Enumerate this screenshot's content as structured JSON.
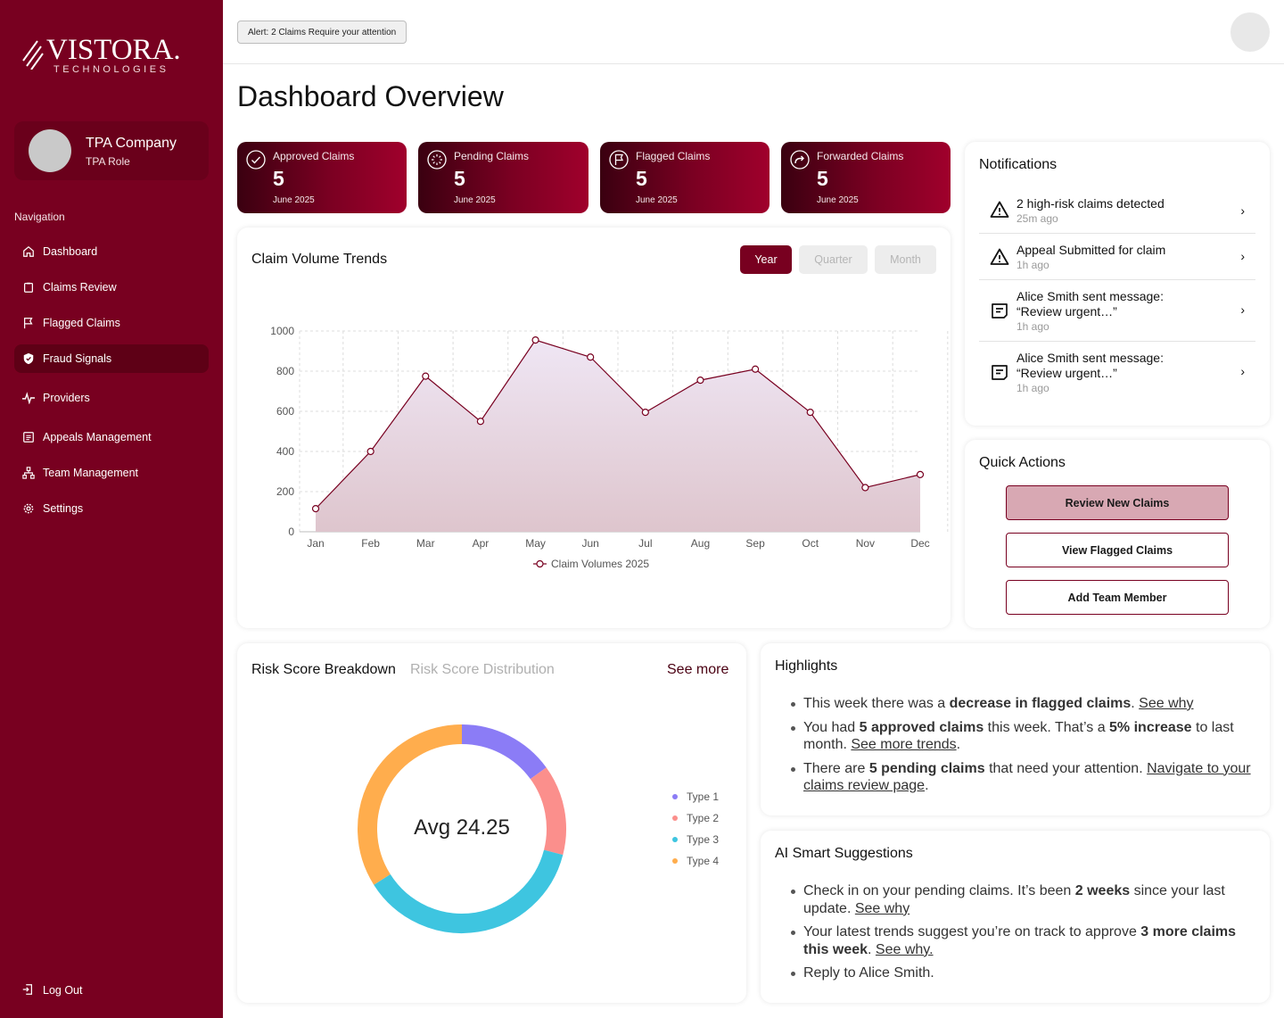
{
  "brand": {
    "name": "VISTORA.",
    "sub": "TECHNOLOGIES"
  },
  "profile": {
    "company": "TPA Company",
    "role": "TPA Role"
  },
  "nav": {
    "title": "Navigation",
    "items": [
      {
        "label": "Dashboard",
        "icon": "home-icon"
      },
      {
        "label": "Claims Review",
        "icon": "clipboard-icon"
      },
      {
        "label": "Flagged Claims",
        "icon": "flag-icon"
      },
      {
        "label": "Fraud Signals",
        "icon": "shield-icon"
      },
      {
        "label": "Providers",
        "icon": "activity-icon"
      },
      {
        "label": "Appeals Management",
        "icon": "document-icon"
      },
      {
        "label": "Team Management",
        "icon": "org-chart-icon"
      },
      {
        "label": "Settings",
        "icon": "gear-icon"
      }
    ],
    "active": "Fraud Signals",
    "logout": "Log Out"
  },
  "topbar": {
    "alert": "Alert: 2 Claims Require your attention"
  },
  "page": {
    "title": "Dashboard Overview"
  },
  "stats": [
    {
      "label": "Approved Claims",
      "value": "5",
      "date": "June 2025",
      "icon": "check-circle-icon"
    },
    {
      "label": "Pending Claims",
      "value": "5",
      "date": "June 2025",
      "icon": "loader-icon"
    },
    {
      "label": "Flagged Claims",
      "value": "5",
      "date": "June 2025",
      "icon": "flag-circle-icon"
    },
    {
      "label": "Forwarded Claims",
      "value": "5",
      "date": "June 2025",
      "icon": "forward-circle-icon"
    }
  ],
  "trends": {
    "title": "Claim Volume Trends",
    "periods": [
      "Year",
      "Quarter",
      "Month"
    ],
    "selected_period": "Year"
  },
  "chart_data": [
    {
      "type": "line",
      "title": "Claim Volume Trends",
      "x": [
        "Jan",
        "Feb",
        "Mar",
        "Apr",
        "May",
        "Jun",
        "Jul",
        "Aug",
        "Sep",
        "Oct",
        "Nov",
        "Dec"
      ],
      "series": [
        {
          "name": "Claim Volumes 2025",
          "values": [
            115,
            400,
            775,
            550,
            955,
            870,
            595,
            755,
            810,
            595,
            220,
            285
          ]
        }
      ],
      "ylim": [
        0,
        1000
      ],
      "yticks": [
        0,
        200,
        400,
        600,
        800,
        1000
      ],
      "grid": true,
      "legend": "bottom",
      "fill": "area",
      "color": "#780020"
    },
    {
      "type": "pie",
      "title": "Risk Score Breakdown",
      "categories": [
        "Type 1",
        "Type 2",
        "Type 3",
        "Type 4"
      ],
      "values": [
        15,
        14,
        37,
        34
      ],
      "colors": [
        "#8b7cf6",
        "#fb8f8c",
        "#3ec5e0",
        "#ffad4d"
      ],
      "center_label": "Avg 24.25",
      "legend": "right"
    }
  ],
  "notifications": {
    "title": "Notifications",
    "items": [
      {
        "line1": "2 high-risk claims detected",
        "line2": "",
        "time": "25m ago",
        "icon": "warning-icon"
      },
      {
        "line1": "Appeal Submitted for claim",
        "line2": "",
        "time": "1h ago",
        "icon": "warning-icon"
      },
      {
        "line1": "Alice Smith sent message:",
        "line2": "“Review urgent…”",
        "time": "1h ago",
        "icon": "message-icon"
      },
      {
        "line1": "Alice Smith sent message:",
        "line2": "“Review urgent…”",
        "time": "1h ago",
        "icon": "message-icon"
      }
    ]
  },
  "quick_actions": {
    "title": "Quick Actions",
    "items": [
      "Review New Claims",
      "View Flagged Claims",
      "Add Team Member"
    ]
  },
  "risk": {
    "title": "Risk Score Breakdown",
    "subtitle": "Risk Score Distribution",
    "see_more": "See more",
    "center": "Avg 24.25"
  },
  "highlights": {
    "title": "Highlights",
    "b1": {
      "pre": "This week there was a ",
      "bold": "decrease in flagged claims",
      "mid": ". ",
      "link": "See why"
    },
    "b2": {
      "pre": "You had ",
      "bold1": "5 approved claims",
      "mid1": " this week. That’s a ",
      "bold2": "5% increase",
      "mid2": " to last month. ",
      "link": "See more trends",
      "end": "."
    },
    "b3": {
      "pre": "There are ",
      "bold": "5 pending claims",
      "mid": " that need your attention. ",
      "link": "Navigate to your claims review page",
      "end": "."
    }
  },
  "ai": {
    "title": "AI Smart Suggestions",
    "b1": {
      "pre": "Check in on your pending claims. It’s been ",
      "bold": "2 weeks",
      "mid": " since your last update. ",
      "link": "See why"
    },
    "b2": {
      "pre": "Your latest trends suggest you’re on track to approve ",
      "bold": "3 more claims this week",
      "mid": ". ",
      "link": "See why."
    },
    "b3": {
      "text": "Reply to Alice Smith."
    }
  }
}
